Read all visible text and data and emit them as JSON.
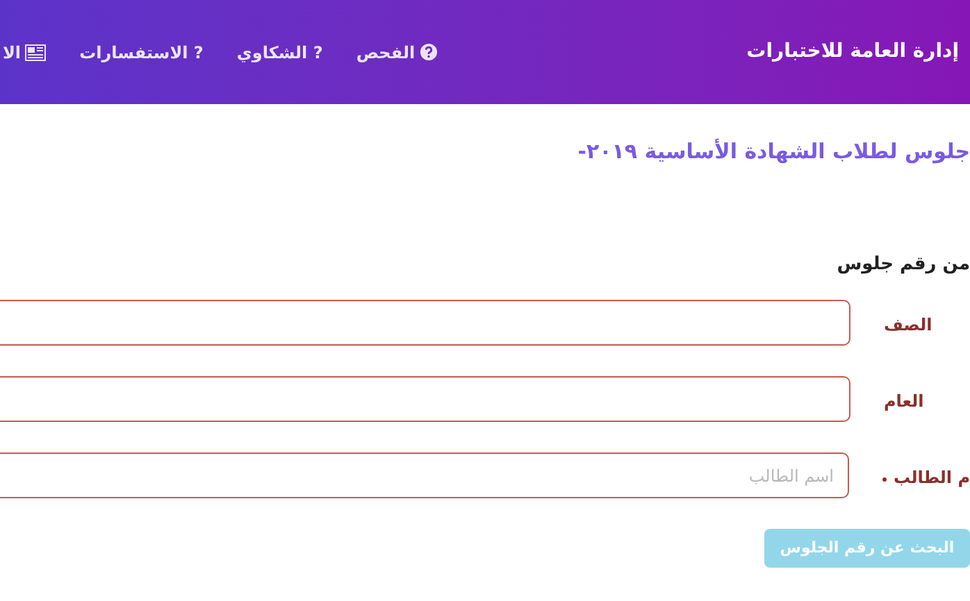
{
  "header": {
    "title": "إدارة العامة للاختبارات",
    "nav": [
      {
        "label": "الفحص",
        "kind": "help"
      },
      {
        "label": "? الشكاوي",
        "kind": "plain"
      },
      {
        "label": "? الاستفسارات",
        "kind": "plain"
      },
      {
        "label": "الا",
        "kind": "news"
      }
    ]
  },
  "heading": "جلوس لطلاب الشهادة الأساسية ٢٠١٩-",
  "subheading": "من رقم جلوس",
  "form": {
    "fields": [
      {
        "label": "الصف",
        "required": false
      },
      {
        "label": "العام",
        "required": false
      },
      {
        "label": "م الطالب",
        "placeholder": "اسم الطالب",
        "required": true
      }
    ],
    "button": "البحث عن رقم الجلوس"
  }
}
